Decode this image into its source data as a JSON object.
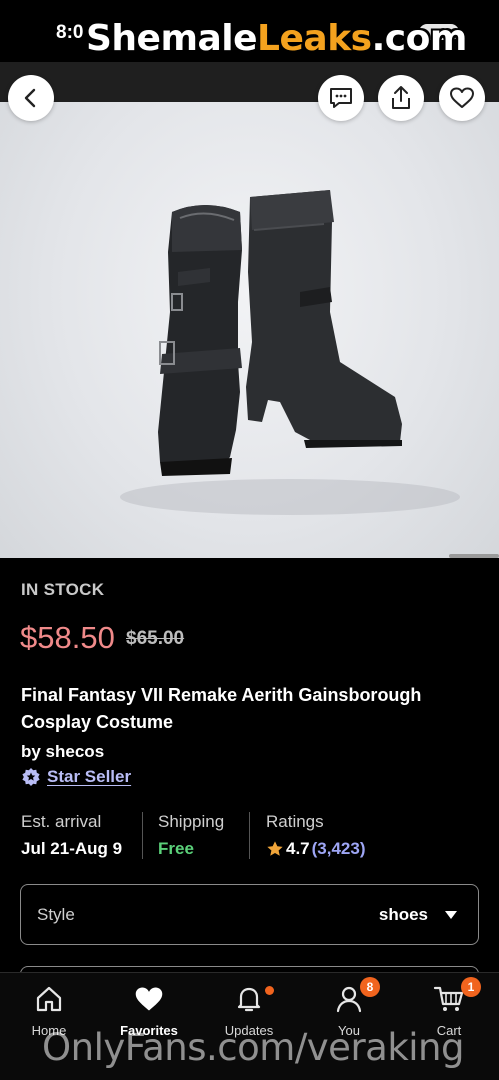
{
  "status_bar": {
    "time": "8:0"
  },
  "watermark_top": {
    "part1": "Shemale",
    "part2": "Leaks",
    "part3": ".com"
  },
  "watermark_bottom": "OnlyFans.com/veraking",
  "product": {
    "stock_status": "IN STOCK",
    "price": "$58.50",
    "original_price": "$65.00",
    "title": "Final Fantasy VII Remake Aerith Gainsborough Cosplay Costume",
    "seller": "by shecos",
    "badge_label": "Star Seller"
  },
  "info": {
    "arrival_label": "Est. arrival",
    "arrival_value": "Jul 21-Aug 9",
    "shipping_label": "Shipping",
    "shipping_value": "Free",
    "ratings_label": "Ratings",
    "rating_value": "4.7",
    "rating_count": "(3,423)"
  },
  "variation": {
    "label": "Style",
    "value": "shoes"
  },
  "tabs": [
    {
      "label": "Home",
      "icon": "home-icon"
    },
    {
      "label": "Favorites",
      "icon": "heart-icon"
    },
    {
      "label": "Updates",
      "icon": "bell-icon"
    },
    {
      "label": "You",
      "icon": "person-icon",
      "badge": "8"
    },
    {
      "label": "Cart",
      "icon": "cart-icon",
      "badge": "1"
    }
  ],
  "colors": {
    "accent": "#f1641e",
    "price": "#f08a8a",
    "free": "#5bd17a",
    "link": "#b9bdf5",
    "watermark": "#f4a21e"
  }
}
